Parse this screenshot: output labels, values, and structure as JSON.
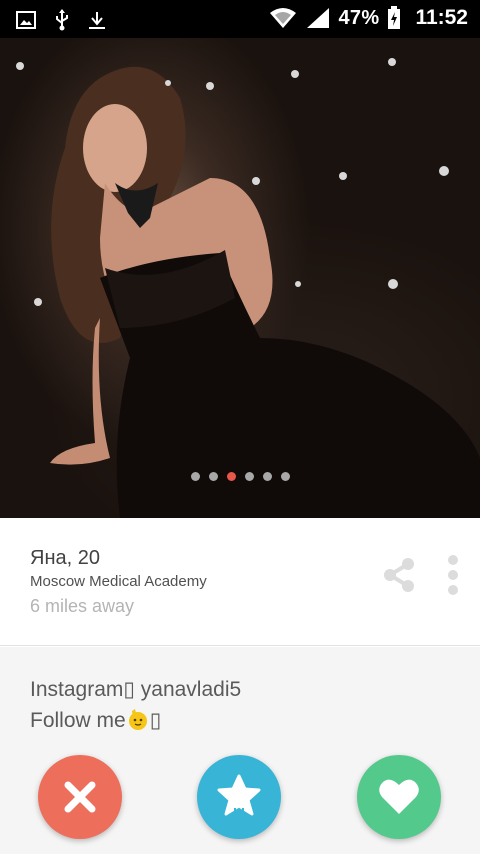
{
  "status_bar": {
    "battery": "47%",
    "time": "11:52",
    "icons": [
      "gallery-icon",
      "usb-icon",
      "download-icon",
      "wifi-icon",
      "signal-icon",
      "battery-icon"
    ]
  },
  "photo": {
    "pages": 6,
    "active_page": 3
  },
  "profile": {
    "name_age": "Яна, 20",
    "school": "Moscow Medical Academy",
    "distance": "6 miles away"
  },
  "bio": {
    "line1": "Instagram▯ yanavladi5",
    "line2_text": "Follow me",
    "line2_tail": "▯"
  },
  "actions": {
    "icons": [
      "close-icon",
      "star-icon",
      "heart-icon"
    ]
  },
  "colors": {
    "nope": "#ed6e5a",
    "superlike": "#37b4d6",
    "like": "#54c98c",
    "active_dot": "#e9574a"
  }
}
